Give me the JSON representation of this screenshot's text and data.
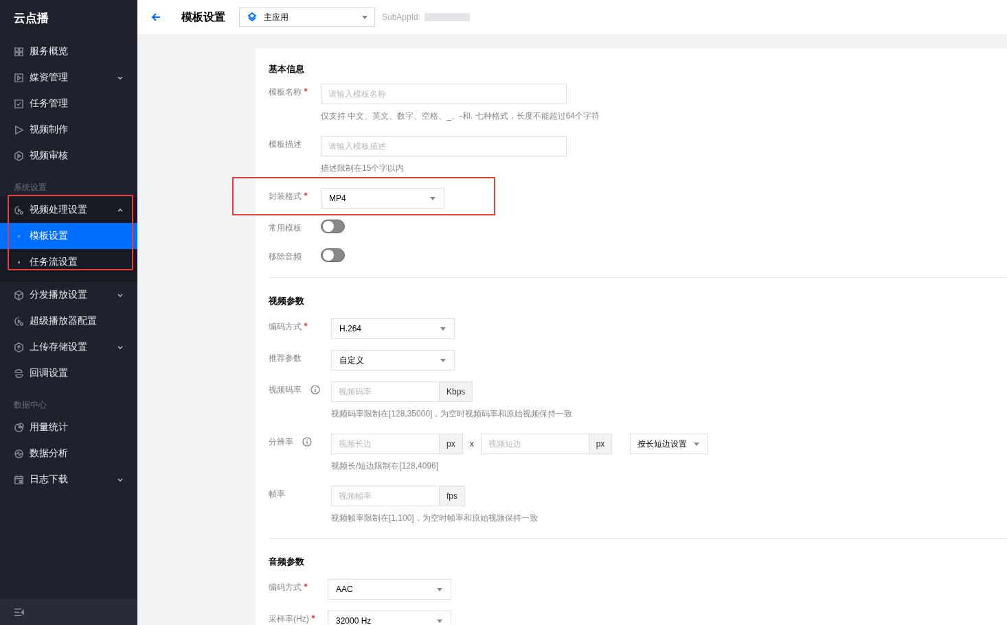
{
  "sidebar": {
    "logo": "云点播",
    "sections": [
      {
        "items": [
          {
            "label": "服务概览",
            "selected": false
          },
          {
            "label": "媒资管理",
            "selected": false,
            "expanded": false
          },
          {
            "label": "任务管理",
            "selected": false
          },
          {
            "label": "视频制作",
            "selected": false
          },
          {
            "label": "视频审核",
            "selected": false
          }
        ]
      },
      {
        "title": "系统设置",
        "items": [
          {
            "label": "视频处理设置",
            "selected": false,
            "expanded": true,
            "highlighted": true,
            "children": [
              {
                "label": "模板设置",
                "selected": true
              },
              {
                "label": "任务流设置",
                "selected": false
              }
            ]
          },
          {
            "label": "分发播放设置",
            "selected": false,
            "expanded": false
          },
          {
            "label": "超级播放器配置",
            "selected": false
          },
          {
            "label": "上传存储设置",
            "selected": false,
            "expanded": false
          },
          {
            "label": "回调设置",
            "selected": false
          }
        ]
      },
      {
        "title": "数据中心",
        "items": [
          {
            "label": "用量统计",
            "selected": false
          },
          {
            "label": "数据分析",
            "selected": false
          },
          {
            "label": "日志下载",
            "selected": false,
            "expanded": false
          }
        ]
      }
    ]
  },
  "header": {
    "title": "模板设置",
    "app_select": {
      "value": "主应用"
    },
    "subappid_label": "SubAppId:"
  },
  "form": {
    "sections": [
      {
        "title": "基本信息",
        "fields": [
          {
            "kind": "input",
            "label": "模板名称",
            "required": true,
            "placeholder": "请输入模板名称",
            "hint": "仅支持 中文、英文、数字、空格、_、-和. 七种格式，长度不能超过64个字符"
          },
          {
            "kind": "input",
            "label": "模板描述",
            "required": false,
            "placeholder": "请输入模板描述",
            "hint": "描述限制在15个字以内"
          },
          {
            "kind": "select",
            "label": "封装格式",
            "required": true,
            "value": "MP4",
            "highlighted": true
          },
          {
            "kind": "switch",
            "label": "常用模板",
            "on": false
          },
          {
            "kind": "switch",
            "label": "移除音频",
            "on": false
          }
        ]
      },
      {
        "title": "视频参数",
        "fields": [
          {
            "kind": "select",
            "label": "编码方式",
            "required": true,
            "value": "H.264"
          },
          {
            "kind": "select",
            "label": "推荐参数",
            "required": false,
            "value": "自定义"
          },
          {
            "kind": "unit_input",
            "label": "视频码率",
            "info": true,
            "placeholder": "视频码率",
            "unit": "Kbps",
            "hint": "视频码率限制在[128,35000]，为空时视频码率和原始视频保持一致"
          },
          {
            "kind": "resolution",
            "label": "分辨率",
            "info": true,
            "inputs": [
              {
                "placeholder": "视频长边",
                "unit": "px"
              },
              {
                "placeholder": "视频短边",
                "unit": "px"
              }
            ],
            "separator": "x",
            "mode": "按长短边设置",
            "hint": "视频长/短边限制在[128,4096]"
          },
          {
            "kind": "unit_input",
            "label": "帧率",
            "info": false,
            "placeholder": "视频帧率",
            "unit": "fps",
            "hint": "视频帧率限制在[1,100]，为空时帧率和原始视频保持一致"
          }
        ]
      },
      {
        "title": "音频参数",
        "fields": [
          {
            "kind": "select",
            "label": "编码方式",
            "required": true,
            "value": "AAC"
          },
          {
            "kind": "select",
            "label": "采样率(Hz)",
            "required": true,
            "value": "32000 Hz"
          }
        ]
      }
    ]
  }
}
